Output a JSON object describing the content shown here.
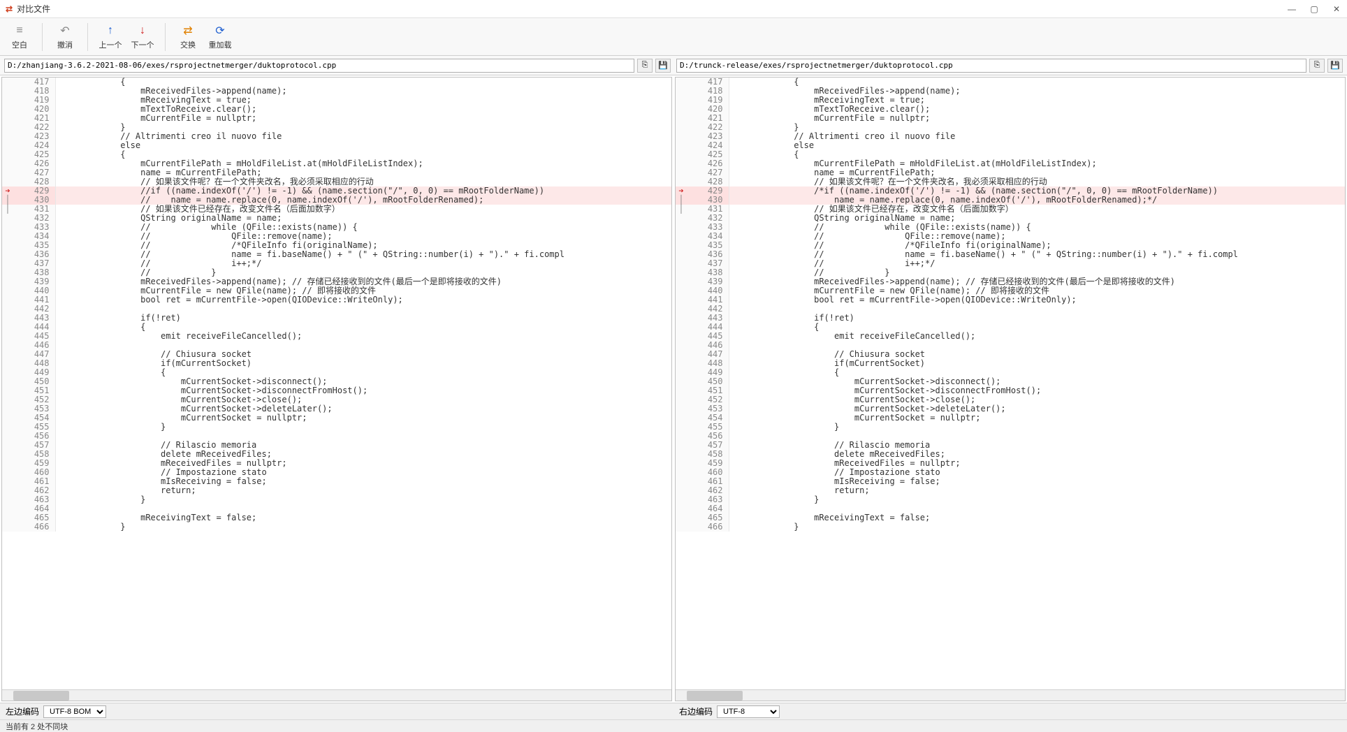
{
  "window": {
    "title": "对比文件",
    "app_icon": "⇄"
  },
  "toolbar": {
    "blank": "空白",
    "undo": "撤消",
    "prev": "上一个",
    "next": "下一个",
    "swap": "交换",
    "reload": "重加载"
  },
  "paths": {
    "left": "D:/zhanjiang-3.6.2-2021-08-06/exes/rsprojectnetmerger/duktoprotocol.cpp",
    "right": "D:/trunck-release/exes/rsprojectnetmerger/duktoprotocol.cpp"
  },
  "encoding": {
    "left_label": "左边编码",
    "left_value": "UTF-8 BOM",
    "right_label": "右边编码",
    "right_value": "UTF-8"
  },
  "status": "当前有 2 处不同块",
  "left_lines": [
    {
      "n": 417,
      "t": "            {"
    },
    {
      "n": 418,
      "t": "                mReceivedFiles->append(name);"
    },
    {
      "n": 419,
      "t": "                mReceivingText = true;"
    },
    {
      "n": 420,
      "t": "                mTextToReceive.clear();"
    },
    {
      "n": 421,
      "t": "                mCurrentFile = nullptr;"
    },
    {
      "n": 422,
      "t": "            }"
    },
    {
      "n": 423,
      "t": "            // Altrimenti creo il nuovo file"
    },
    {
      "n": 424,
      "t": "            else"
    },
    {
      "n": 425,
      "t": "            {"
    },
    {
      "n": 426,
      "t": "                mCurrentFilePath = mHoldFileList.at(mHoldFileListIndex);"
    },
    {
      "n": 427,
      "t": "                name = mCurrentFilePath;"
    },
    {
      "n": 428,
      "t": "                // 如果该文件呢？在一个文件夹改名，我必须采取相应的行动"
    },
    {
      "n": 429,
      "t": "                //if ((name.indexOf('/') != -1) && (name.section(\"/\", 0, 0) == mRootFolderName))",
      "d": true,
      "m": "arrow"
    },
    {
      "n": 430,
      "t": "                //    name = name.replace(0, name.indexOf('/'), mRootFolderRenamed);",
      "d": true,
      "m": "bar"
    },
    {
      "n": 431,
      "t": "                // 如果该文件已经存在，改变文件名（后面加数字）",
      "m": "bar"
    },
    {
      "n": 432,
      "t": "                QString originalName = name;"
    },
    {
      "n": 433,
      "t": "                //            while (QFile::exists(name)) {"
    },
    {
      "n": 434,
      "t": "                //                QFile::remove(name);"
    },
    {
      "n": 435,
      "t": "                //                /*QFileInfo fi(originalName);"
    },
    {
      "n": 436,
      "t": "                //                name = fi.baseName() + \" (\" + QString::number(i) + \").\" + fi.compl"
    },
    {
      "n": 437,
      "t": "                //                i++;*/"
    },
    {
      "n": 438,
      "t": "                //            }"
    },
    {
      "n": 439,
      "t": "                mReceivedFiles->append(name); // 存储已经接收到的文件(最后一个是即将接收的文件)"
    },
    {
      "n": 440,
      "t": "                mCurrentFile = new QFile(name); // 即将接收的文件"
    },
    {
      "n": 441,
      "t": "                bool ret = mCurrentFile->open(QIODevice::WriteOnly);"
    },
    {
      "n": 442,
      "t": ""
    },
    {
      "n": 443,
      "t": "                if(!ret)"
    },
    {
      "n": 444,
      "t": "                {"
    },
    {
      "n": 445,
      "t": "                    emit receiveFileCancelled();"
    },
    {
      "n": 446,
      "t": ""
    },
    {
      "n": 447,
      "t": "                    // Chiusura socket"
    },
    {
      "n": 448,
      "t": "                    if(mCurrentSocket)"
    },
    {
      "n": 449,
      "t": "                    {"
    },
    {
      "n": 450,
      "t": "                        mCurrentSocket->disconnect();"
    },
    {
      "n": 451,
      "t": "                        mCurrentSocket->disconnectFromHost();"
    },
    {
      "n": 452,
      "t": "                        mCurrentSocket->close();"
    },
    {
      "n": 453,
      "t": "                        mCurrentSocket->deleteLater();"
    },
    {
      "n": 454,
      "t": "                        mCurrentSocket = nullptr;"
    },
    {
      "n": 455,
      "t": "                    }"
    },
    {
      "n": 456,
      "t": ""
    },
    {
      "n": 457,
      "t": "                    // Rilascio memoria"
    },
    {
      "n": 458,
      "t": "                    delete mReceivedFiles;"
    },
    {
      "n": 459,
      "t": "                    mReceivedFiles = nullptr;"
    },
    {
      "n": 460,
      "t": "                    // Impostazione stato"
    },
    {
      "n": 461,
      "t": "                    mIsReceiving = false;"
    },
    {
      "n": 462,
      "t": "                    return;"
    },
    {
      "n": 463,
      "t": "                }"
    },
    {
      "n": 464,
      "t": ""
    },
    {
      "n": 465,
      "t": "                mReceivingText = false;"
    },
    {
      "n": 466,
      "t": "            }"
    }
  ],
  "right_lines": [
    {
      "n": 417,
      "t": "            {"
    },
    {
      "n": 418,
      "t": "                mReceivedFiles->append(name);"
    },
    {
      "n": 419,
      "t": "                mReceivingText = true;"
    },
    {
      "n": 420,
      "t": "                mTextToReceive.clear();"
    },
    {
      "n": 421,
      "t": "                mCurrentFile = nullptr;"
    },
    {
      "n": 422,
      "t": "            }"
    },
    {
      "n": 423,
      "t": "            // Altrimenti creo il nuovo file"
    },
    {
      "n": 424,
      "t": "            else"
    },
    {
      "n": 425,
      "t": "            {"
    },
    {
      "n": 426,
      "t": "                mCurrentFilePath = mHoldFileList.at(mHoldFileListIndex);"
    },
    {
      "n": 427,
      "t": "                name = mCurrentFilePath;"
    },
    {
      "n": 428,
      "t": "                // 如果该文件呢？在一个文件夹改名，我必须采取相应的行动"
    },
    {
      "n": 429,
      "t": "                /*if ((name.indexOf('/') != -1) && (name.section(\"/\", 0, 0) == mRootFolderName))",
      "d": true,
      "m": "arrow"
    },
    {
      "n": 430,
      "t": "                    name = name.replace(0, name.indexOf('/'), mRootFolderRenamed);*/",
      "d": true,
      "m": "bar"
    },
    {
      "n": 431,
      "t": "                // 如果该文件已经存在，改变文件名（后面加数字）",
      "m": "bar"
    },
    {
      "n": 432,
      "t": "                QString originalName = name;"
    },
    {
      "n": 433,
      "t": "                //            while (QFile::exists(name)) {"
    },
    {
      "n": 434,
      "t": "                //                QFile::remove(name);"
    },
    {
      "n": 435,
      "t": "                //                /*QFileInfo fi(originalName);"
    },
    {
      "n": 436,
      "t": "                //                name = fi.baseName() + \" (\" + QString::number(i) + \").\" + fi.compl"
    },
    {
      "n": 437,
      "t": "                //                i++;*/"
    },
    {
      "n": 438,
      "t": "                //            }"
    },
    {
      "n": 439,
      "t": "                mReceivedFiles->append(name); // 存储已经接收到的文件(最后一个是即将接收的文件)"
    },
    {
      "n": 440,
      "t": "                mCurrentFile = new QFile(name); // 即将接收的文件"
    },
    {
      "n": 441,
      "t": "                bool ret = mCurrentFile->open(QIODevice::WriteOnly);"
    },
    {
      "n": 442,
      "t": ""
    },
    {
      "n": 443,
      "t": "                if(!ret)"
    },
    {
      "n": 444,
      "t": "                {"
    },
    {
      "n": 445,
      "t": "                    emit receiveFileCancelled();"
    },
    {
      "n": 446,
      "t": ""
    },
    {
      "n": 447,
      "t": "                    // Chiusura socket"
    },
    {
      "n": 448,
      "t": "                    if(mCurrentSocket)"
    },
    {
      "n": 449,
      "t": "                    {"
    },
    {
      "n": 450,
      "t": "                        mCurrentSocket->disconnect();"
    },
    {
      "n": 451,
      "t": "                        mCurrentSocket->disconnectFromHost();"
    },
    {
      "n": 452,
      "t": "                        mCurrentSocket->close();"
    },
    {
      "n": 453,
      "t": "                        mCurrentSocket->deleteLater();"
    },
    {
      "n": 454,
      "t": "                        mCurrentSocket = nullptr;"
    },
    {
      "n": 455,
      "t": "                    }"
    },
    {
      "n": 456,
      "t": ""
    },
    {
      "n": 457,
      "t": "                    // Rilascio memoria"
    },
    {
      "n": 458,
      "t": "                    delete mReceivedFiles;"
    },
    {
      "n": 459,
      "t": "                    mReceivedFiles = nullptr;"
    },
    {
      "n": 460,
      "t": "                    // Impostazione stato"
    },
    {
      "n": 461,
      "t": "                    mIsReceiving = false;"
    },
    {
      "n": 462,
      "t": "                    return;"
    },
    {
      "n": 463,
      "t": "                }"
    },
    {
      "n": 464,
      "t": ""
    },
    {
      "n": 465,
      "t": "                mReceivingText = false;"
    },
    {
      "n": 466,
      "t": "            }"
    }
  ]
}
